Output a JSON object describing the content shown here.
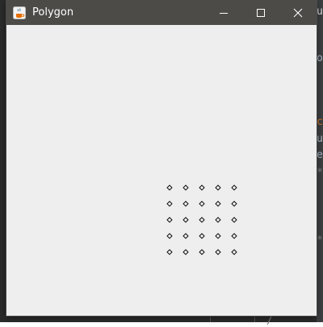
{
  "window": {
    "title": "Polygon",
    "icon": "java-coffee-icon",
    "controls": [
      "minimize-icon",
      "maximize-icon",
      "close-icon"
    ]
  },
  "canvas": {
    "background": "#eeeeee",
    "marker_shape": "diamond",
    "marker_color": "#000000",
    "grid": {
      "rows": 5,
      "cols": 5
    }
  },
  "backdrop": {
    "fragments": [
      "u",
      "o",
      "c",
      "u",
      "e",
      "*",
      "*",
      "/"
    ]
  }
}
